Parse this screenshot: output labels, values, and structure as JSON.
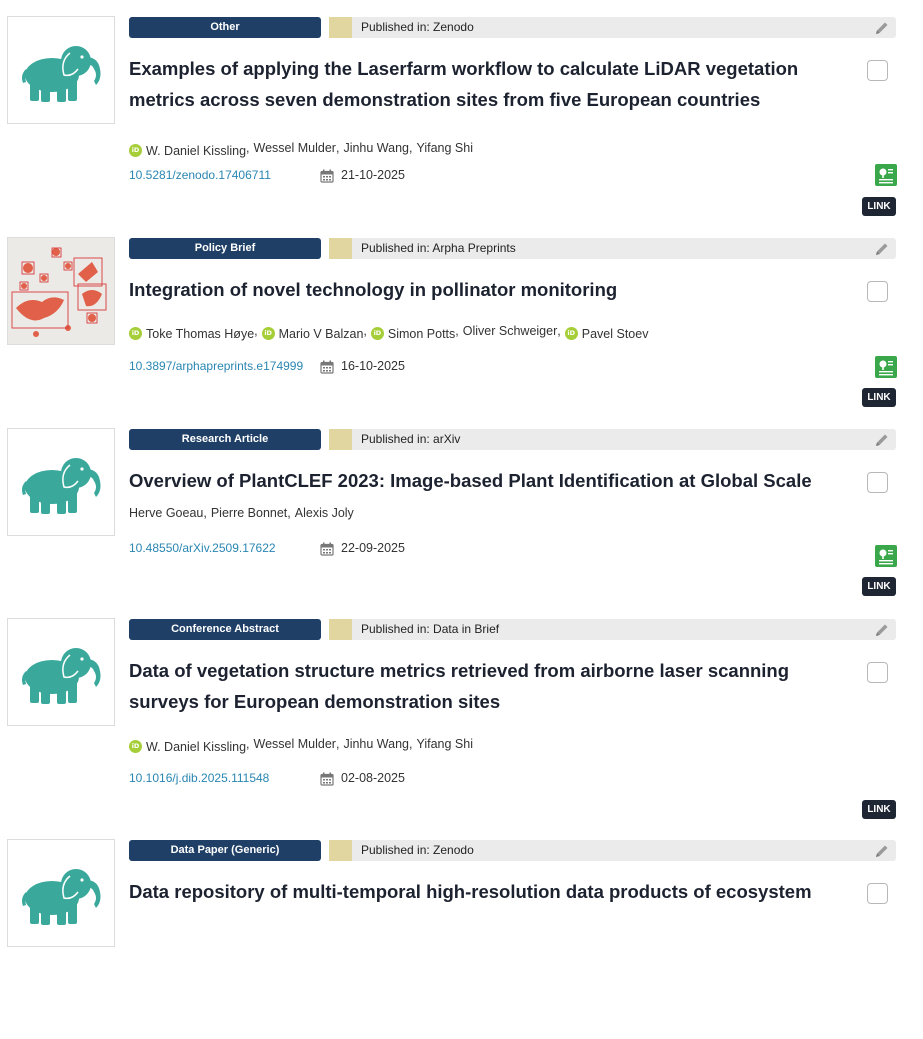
{
  "entries": [
    {
      "type": "Other",
      "published_in": "Published in: Zenodo",
      "title_lines": [
        "Examples of applying the Laserfarm workflow to calculate LiDAR vegetation",
        "metrics across seven demonstration sites from five European countries"
      ],
      "authors": [
        "W. Daniel Kissling",
        "Wessel Mulder",
        "Jinhu Wang",
        "Yifang Shi"
      ],
      "orcid": [
        true,
        false,
        false,
        false
      ],
      "doi": "10.5281/zenodo.17406711",
      "date": "21-10-2025",
      "link_label": "LINK",
      "thumb": "elephant"
    },
    {
      "type": "Policy Brief",
      "published_in": "Published in: Arpha Preprints",
      "title_lines": [
        "Integration of novel technology in pollinator monitoring"
      ],
      "authors": [
        "Toke Thomas Høye",
        "Mario V Balzan",
        "Simon Potts",
        "Oliver Schweiger",
        "Pavel Stoev"
      ],
      "orcid": [
        true,
        true,
        true,
        false,
        true
      ],
      "doi": "10.3897/arphapreprints.e174999",
      "date": "16-10-2025",
      "link_label": "LINK",
      "thumb": "moths"
    },
    {
      "type": "Research Article",
      "published_in": "Published in: arXiv",
      "title_lines": [
        "Overview of PlantCLEF 2023: Image-based Plant Identification at Global Scale"
      ],
      "authors": [
        "Herve Goeau",
        "Pierre Bonnet",
        "Alexis Joly"
      ],
      "orcid": [
        false,
        false,
        false
      ],
      "doi": "10.48550/arXiv.2509.17622",
      "date": "22-09-2025",
      "link_label": "LINK",
      "thumb": "elephant"
    },
    {
      "type": "Conference Abstract",
      "published_in": "Published in: Data in Brief",
      "title_lines": [
        "Data of vegetation structure metrics retrieved from airborne laser scanning",
        "surveys for European demonstration sites"
      ],
      "authors": [
        "W. Daniel Kissling",
        "Wessel Mulder",
        "Jinhu Wang",
        "Yifang Shi"
      ],
      "orcid": [
        true,
        false,
        false,
        false
      ],
      "doi": "10.1016/j.dib.2025.111548",
      "date": "02-08-2025",
      "link_label": "LINK",
      "thumb": "elephant"
    },
    {
      "type": "Data Paper (Generic)",
      "published_in": "Published in: Zenodo",
      "title_lines": [
        "Data repository of multi-temporal high-resolution data products of ecosystem"
      ],
      "authors": [],
      "orcid": [],
      "doi": "",
      "date": "",
      "link_label": "",
      "thumb": "elephant"
    }
  ],
  "icons": {
    "orcid_text": "iD",
    "colors": {
      "type_badge": "#1f3f66",
      "publisher_swatch": "#e2d6a0",
      "doi_link": "#2a86b2",
      "green_icon": "#3aa84a",
      "link_button": "#1e2633",
      "elephant": "#3aa99c",
      "orcid": "#a6ce39"
    }
  }
}
